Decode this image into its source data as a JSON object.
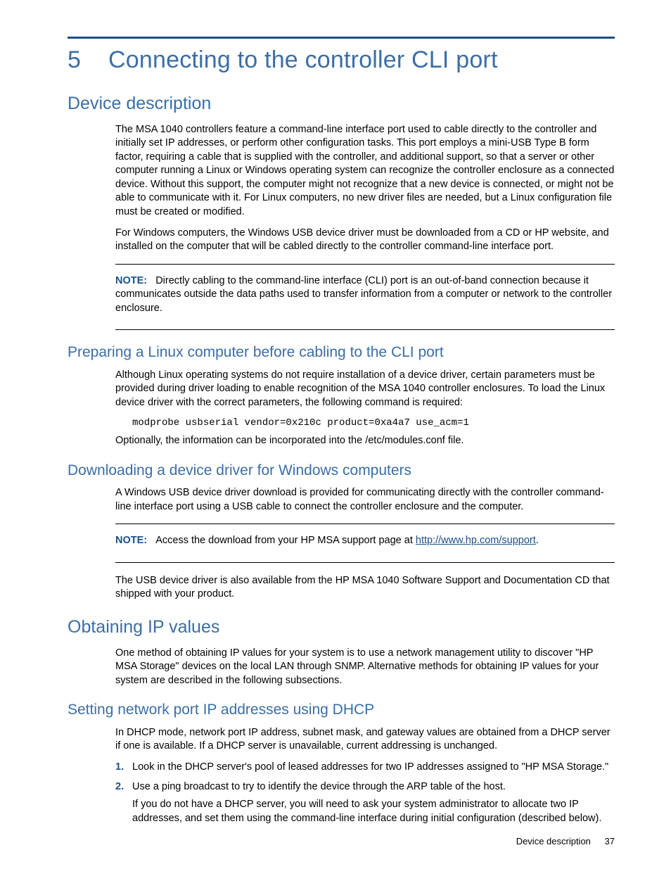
{
  "chapter": {
    "number": "5",
    "title": "Connecting to the controller CLI port"
  },
  "s1": {
    "heading": "Device description",
    "p1": "The MSA 1040 controllers feature a command-line interface port used to cable directly to the controller and initially set IP addresses, or perform other configuration tasks. This port employs a mini-USB Type B form factor, requiring a cable that is supplied with the controller, and additional support, so that a server or other computer running a Linux or Windows operating system can recognize the controller enclosure as a connected device. Without this support, the computer might not recognize that a new device is connected, or might not be able to communicate with it. For Linux computers, no new driver files are needed, but a Linux configuration file must be created or modified.",
    "p2": "For Windows computers, the Windows USB device driver must be downloaded from a CD or HP website, and installed on the computer that will be cabled directly to the controller command-line interface port.",
    "note_label": "NOTE:",
    "note_text": "Directly cabling to the command-line interface (CLI) port is an out-of-band connection because it communicates outside the data paths used to transfer information from a computer or network to the controller enclosure."
  },
  "s1a": {
    "heading": "Preparing a Linux computer before cabling to the CLI port",
    "p1": "Although Linux operating systems do not require installation of a device driver, certain parameters must be provided during driver loading to enable recognition of the MSA 1040 controller enclosures. To load the Linux device driver with the correct parameters, the following command is required:",
    "code": "modprobe usbserial vendor=0x210c product=0xa4a7 use_acm=1",
    "p2": "Optionally, the information can be incorporated into the /etc/modules.conf file."
  },
  "s1b": {
    "heading": "Downloading a device driver for Windows computers",
    "p1": "A Windows USB device driver download is provided for communicating directly with the controller command-line interface port using a USB cable to connect the controller enclosure and the computer.",
    "note_label": "NOTE:",
    "note_pre": "Access the download from your HP MSA support page at ",
    "note_link": "http://www.hp.com/support",
    "note_post": ".",
    "p2": "The USB device driver is also available from the HP MSA 1040 Software Support and Documentation CD that shipped with your product."
  },
  "s2": {
    "heading": "Obtaining IP values",
    "p1": "One method of obtaining IP values for your system is to use a network management utility to discover \"HP MSA Storage\" devices on the local LAN through SNMP. Alternative methods for obtaining IP values for your system are described in the following subsections."
  },
  "s2a": {
    "heading": "Setting network port IP addresses using DHCP",
    "p1": "In DHCP mode, network port IP address, subnet mask, and gateway values are obtained from a DHCP server if one is available. If a DHCP server is unavailable, current addressing is unchanged.",
    "li1": "Look in the DHCP server's pool of leased addresses for two IP addresses assigned to \"HP MSA Storage.\"",
    "li2": "Use a ping broadcast to try to identify the device through the ARP table of the host.",
    "li2_follow": "If you do not have a DHCP server, you will need to ask your system administrator to allocate two IP addresses, and set them using the command-line interface during initial configuration (described below)."
  },
  "footer": {
    "section": "Device description",
    "page": "37"
  }
}
